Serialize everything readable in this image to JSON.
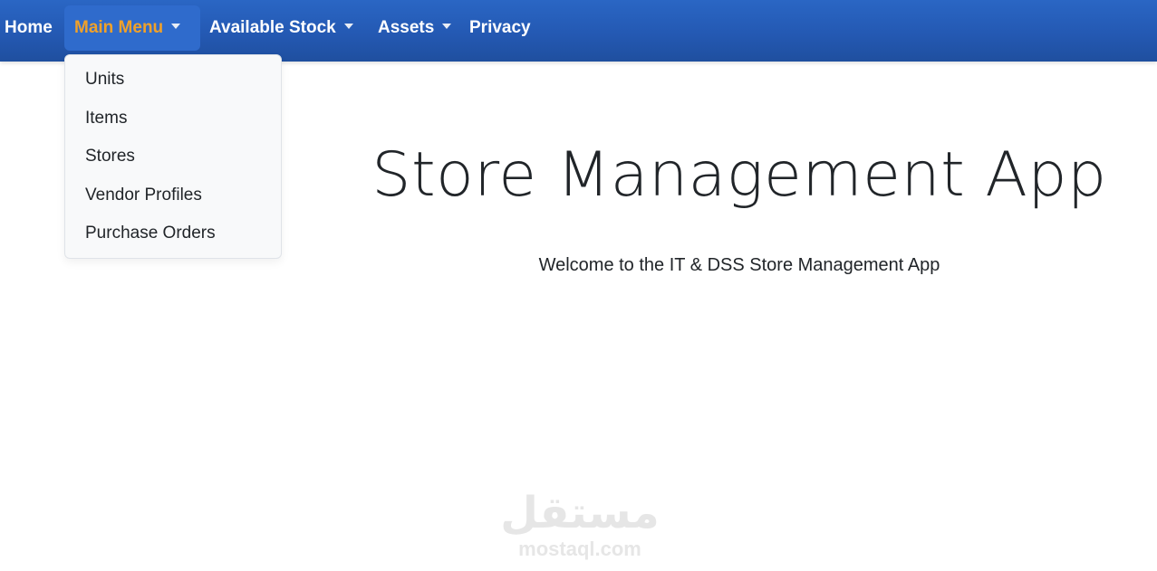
{
  "navbar": {
    "items": [
      {
        "label": "Home"
      },
      {
        "label": "Main Menu"
      },
      {
        "label": "Available Stock"
      },
      {
        "label": "Assets"
      },
      {
        "label": "Privacy"
      }
    ]
  },
  "dropdown": {
    "items": [
      {
        "label": "Units"
      },
      {
        "label": "Items"
      },
      {
        "label": "Stores"
      },
      {
        "label": "Vendor Profiles"
      },
      {
        "label": "Purchase Orders"
      }
    ]
  },
  "hero": {
    "title": "Store Management App",
    "subtitle": "Welcome to the IT & DSS Store Management App"
  },
  "watermark": {
    "logo": "مستقل",
    "text": "mostaql.com"
  },
  "colors": {
    "navbar": "#2459b3",
    "active_text": "#f0a12a",
    "text": "#212529"
  }
}
